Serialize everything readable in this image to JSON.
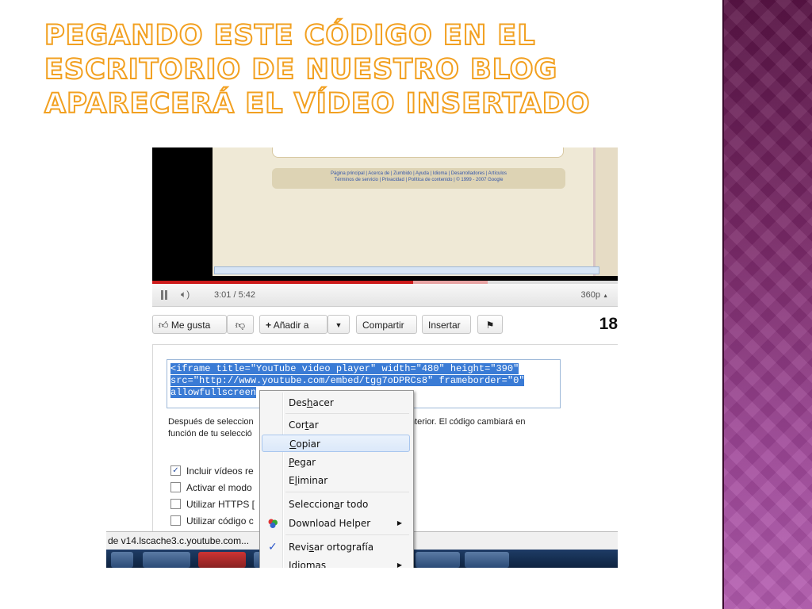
{
  "slide": {
    "title": "Pegando este código en el escritorio de nuestro blog aparecerá el vídeo insertado"
  },
  "video": {
    "footer_links_line1": "Página principal | Acerca de | Zumbido | Ayuda | Idioma | Desarrolladores | Artículos",
    "footer_links_line2": "Términos de servicio | Privacidad | Política de contenido | © 1999 - 2007 Google",
    "progress_played_fraction": 0.56,
    "progress_loaded_fraction": 0.72,
    "time": "3:01 / 5:42",
    "quality": "360p"
  },
  "actions": {
    "like": "Me gusta",
    "add": "Añadir a",
    "share": "Compartir",
    "embed": "Insertar",
    "count": "18"
  },
  "share": {
    "code_line1": "<iframe title=\"YouTube video player\" width=\"480\" height=\"390\"",
    "code_line2": "src=\"http://www.youtube.com/embed/tgg7oDPRCs8\" frameborder=\"0\"",
    "code_line3": "allowfullscreen",
    "desc_a": "Después de seleccion",
    "desc_b": "n anterior. El código cambiará en",
    "desc_c": "función de tu selecció",
    "checkbox_include": "Incluir vídeos re",
    "checkbox_privacy": "Activar el modo",
    "checkbox_https": "Utilizar HTTPS [",
    "checkbox_old": "Utilizar código c"
  },
  "status": {
    "text": "de v14.lscache3.c.youtube.com..."
  },
  "context_menu": {
    "undo": [
      "Des",
      "h",
      "acer"
    ],
    "cut": [
      "Cor",
      "t",
      "ar"
    ],
    "copy": [
      "",
      "C",
      "opiar"
    ],
    "paste": [
      "",
      "P",
      "egar"
    ],
    "delete": [
      "E",
      "l",
      "iminar"
    ],
    "select_all": [
      "Seleccion",
      "a",
      "r todo"
    ],
    "download_helper": "Download Helper",
    "spellcheck": [
      "Revi",
      "s",
      "ar ortografía"
    ],
    "languages": [
      "",
      "I",
      "diomas"
    ]
  },
  "colors": {
    "title_stroke": "#f2a020",
    "side_band": "#7c2a6a",
    "selection": "#3a7bd5",
    "progress": "#cc1a1a"
  }
}
